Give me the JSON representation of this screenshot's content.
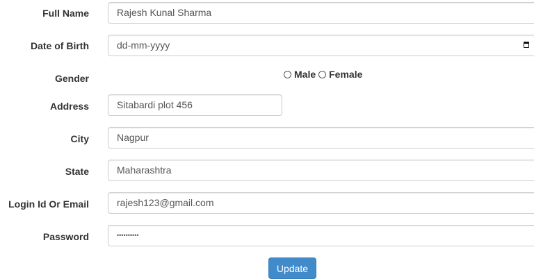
{
  "form": {
    "fields": {
      "full_name": {
        "label": "Full Name",
        "value": "Rajesh Kunal Sharma"
      },
      "dob": {
        "label": "Date of Birth",
        "placeholder": "dd-mm-yyyy"
      },
      "gender": {
        "label": "Gender",
        "options": [
          "Male",
          "Female"
        ]
      },
      "address": {
        "label": "Address",
        "value": "Sitabardi plot 456"
      },
      "city": {
        "label": "City",
        "value": "Nagpur"
      },
      "state": {
        "label": "State",
        "value": "Maharashtra"
      },
      "login": {
        "label": "Login Id Or Email",
        "value": "rajesh123@gmail.com"
      },
      "password": {
        "label": "Password",
        "value": "••••••••••"
      }
    },
    "submit_label": "Update"
  },
  "colors": {
    "button_bg": "#428bca",
    "label_text": "#333333",
    "input_border": "#cccccc"
  },
  "icons": {
    "date_picker": "calendar-icon"
  }
}
